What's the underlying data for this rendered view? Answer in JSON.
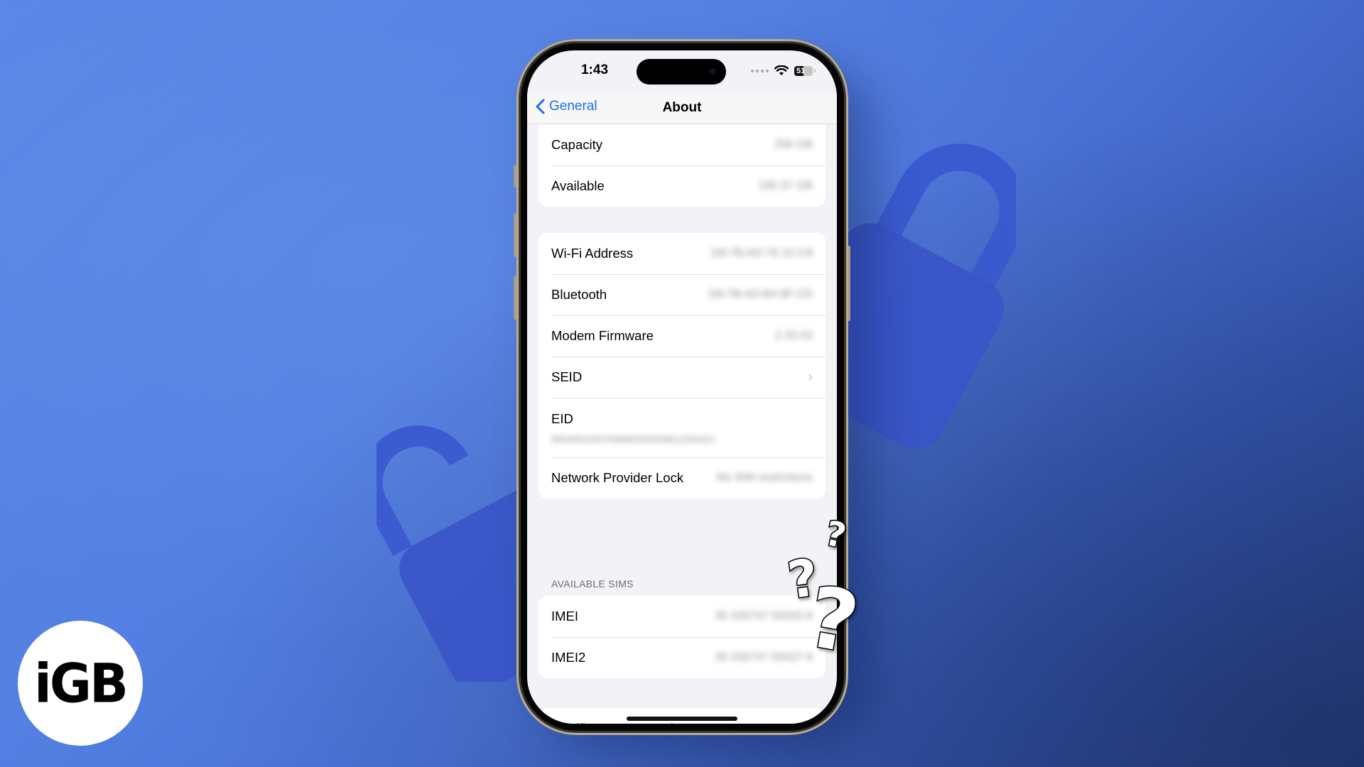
{
  "colors": {
    "background": "#5380e2",
    "lock_shape": "#3a58cf",
    "ios_blue": "#1a73e8",
    "screen_bg": "#f2f2f7"
  },
  "status_bar": {
    "time": "1:43",
    "signal_icon": "cellular-dots-icon",
    "wifi_icon": "wifi-icon",
    "battery_level": "51"
  },
  "nav": {
    "back_label": "General",
    "title": "About"
  },
  "groups": [
    {
      "rows": [
        {
          "label": "Capacity",
          "value": "256 GB",
          "blurred": true
        },
        {
          "label": "Available",
          "value": "190.37 GB",
          "blurred": true
        }
      ]
    },
    {
      "rows": [
        {
          "label": "Wi-Fi Address",
          "value": "D8:7B:AD:7E:31:C8",
          "blurred": true
        },
        {
          "label": "Bluetooth",
          "value": "D8:7B:AD:B4:9F:CD",
          "blurred": true
        },
        {
          "label": "Modem Firmware",
          "value": "2.20.03",
          "blurred": true
        },
        {
          "label": "SEID",
          "chevron": true
        },
        {
          "label": "EID",
          "value": "89049032007008882600009612563421",
          "blurred": true
        },
        {
          "label": "Network Provider Lock",
          "value": "No SIM restrictions",
          "blurred": true
        }
      ]
    },
    {
      "header": "AVAILABLE SIMS",
      "rows": [
        {
          "label": "IMEI",
          "value": "35 330747 59343 8",
          "blurred": true
        },
        {
          "label": "IMEI2",
          "value": "35 330747 59427 6",
          "blurred": true
        }
      ]
    },
    {
      "rows": [
        {
          "label": "Certificate Trust Settings",
          "chevron": true
        }
      ]
    }
  ],
  "overlay": {
    "question_marks_icon": "question-marks-icon",
    "question_mark_glyph": "?"
  },
  "logo": {
    "text": "iGB"
  }
}
